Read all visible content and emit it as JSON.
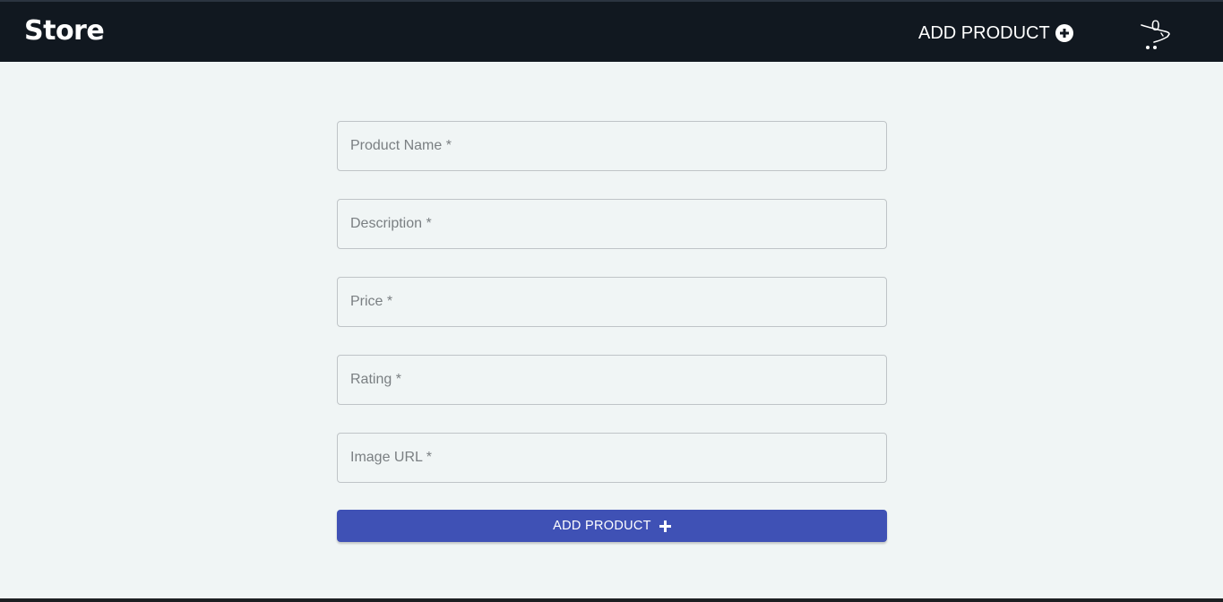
{
  "header": {
    "brand": "Store",
    "add_product_label": "ADD PRODUCT",
    "add_icon": "plus-circle-icon",
    "cart_icon": "cart-icon",
    "cart_count": "0"
  },
  "form": {
    "fields": [
      {
        "label": "Product Name *"
      },
      {
        "label": "Description *"
      },
      {
        "label": "Price *"
      },
      {
        "label": "Rating *"
      },
      {
        "label": "Image URL *"
      }
    ],
    "submit_label": "ADD PRODUCT",
    "submit_icon": "plus-icon"
  },
  "colors": {
    "navbar": "#111820",
    "background": "#f0f5f5",
    "primary": "#3f51b5"
  }
}
